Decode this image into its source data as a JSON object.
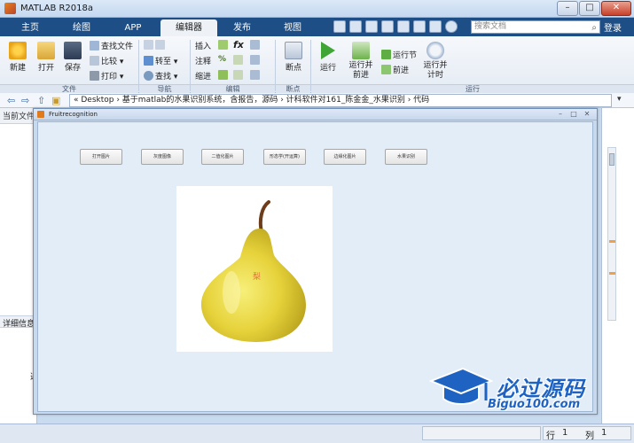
{
  "window": {
    "title": "MATLAB R2018a"
  },
  "tabs": [
    "主页",
    "绘图",
    "APP",
    "编辑器",
    "发布",
    "视图"
  ],
  "active_tab": "编辑器",
  "search": {
    "placeholder": "搜索文档"
  },
  "login_label": "登录",
  "ribbon": {
    "file_group": {
      "label": "文件",
      "new_label": "新建",
      "open_label": "打开",
      "save_label": "保存",
      "find_files_label": "查找文件",
      "compare_label": "比较",
      "print_label": "打印"
    },
    "navigate_group": {
      "label": "导航",
      "goto_label": "转至",
      "find_label": "查找"
    },
    "edit_group": {
      "label": "编辑",
      "insert_label": "插入",
      "comment_label": "注释",
      "indent_label": "缩进",
      "fx_label": "fx"
    },
    "breakpoint_group": {
      "label": "断点",
      "breakpoints_label": "断点"
    },
    "run_group": {
      "label": "运行",
      "run_label": "运行",
      "run_advance_label": "运行并前进",
      "run_section_label": "运行节",
      "advance_label": "前进",
      "run_time_label": "运行并计时"
    }
  },
  "address": {
    "path": "« Desktop › 基于matlab的水果识别系统，含报告，源码 › 计科软件对161_陈金金_水果识别 › 代码"
  },
  "left_panel": {
    "title": "当前文件夹",
    "detail_title": "详细信息",
    "select_hint": "选"
  },
  "figure": {
    "title": "Fruitrecognition",
    "buttons": [
      "打开图片",
      "灰度图像",
      "二值化图片",
      "形态学(开运算)",
      "边缘化图片",
      "水果识别"
    ],
    "result_label": "梨"
  },
  "watermark": {
    "brand": "必过源码",
    "url": "Biguo100.com"
  },
  "status": {
    "row_label": "行",
    "row_value": "1",
    "col_label": "列",
    "col_value": "1"
  }
}
